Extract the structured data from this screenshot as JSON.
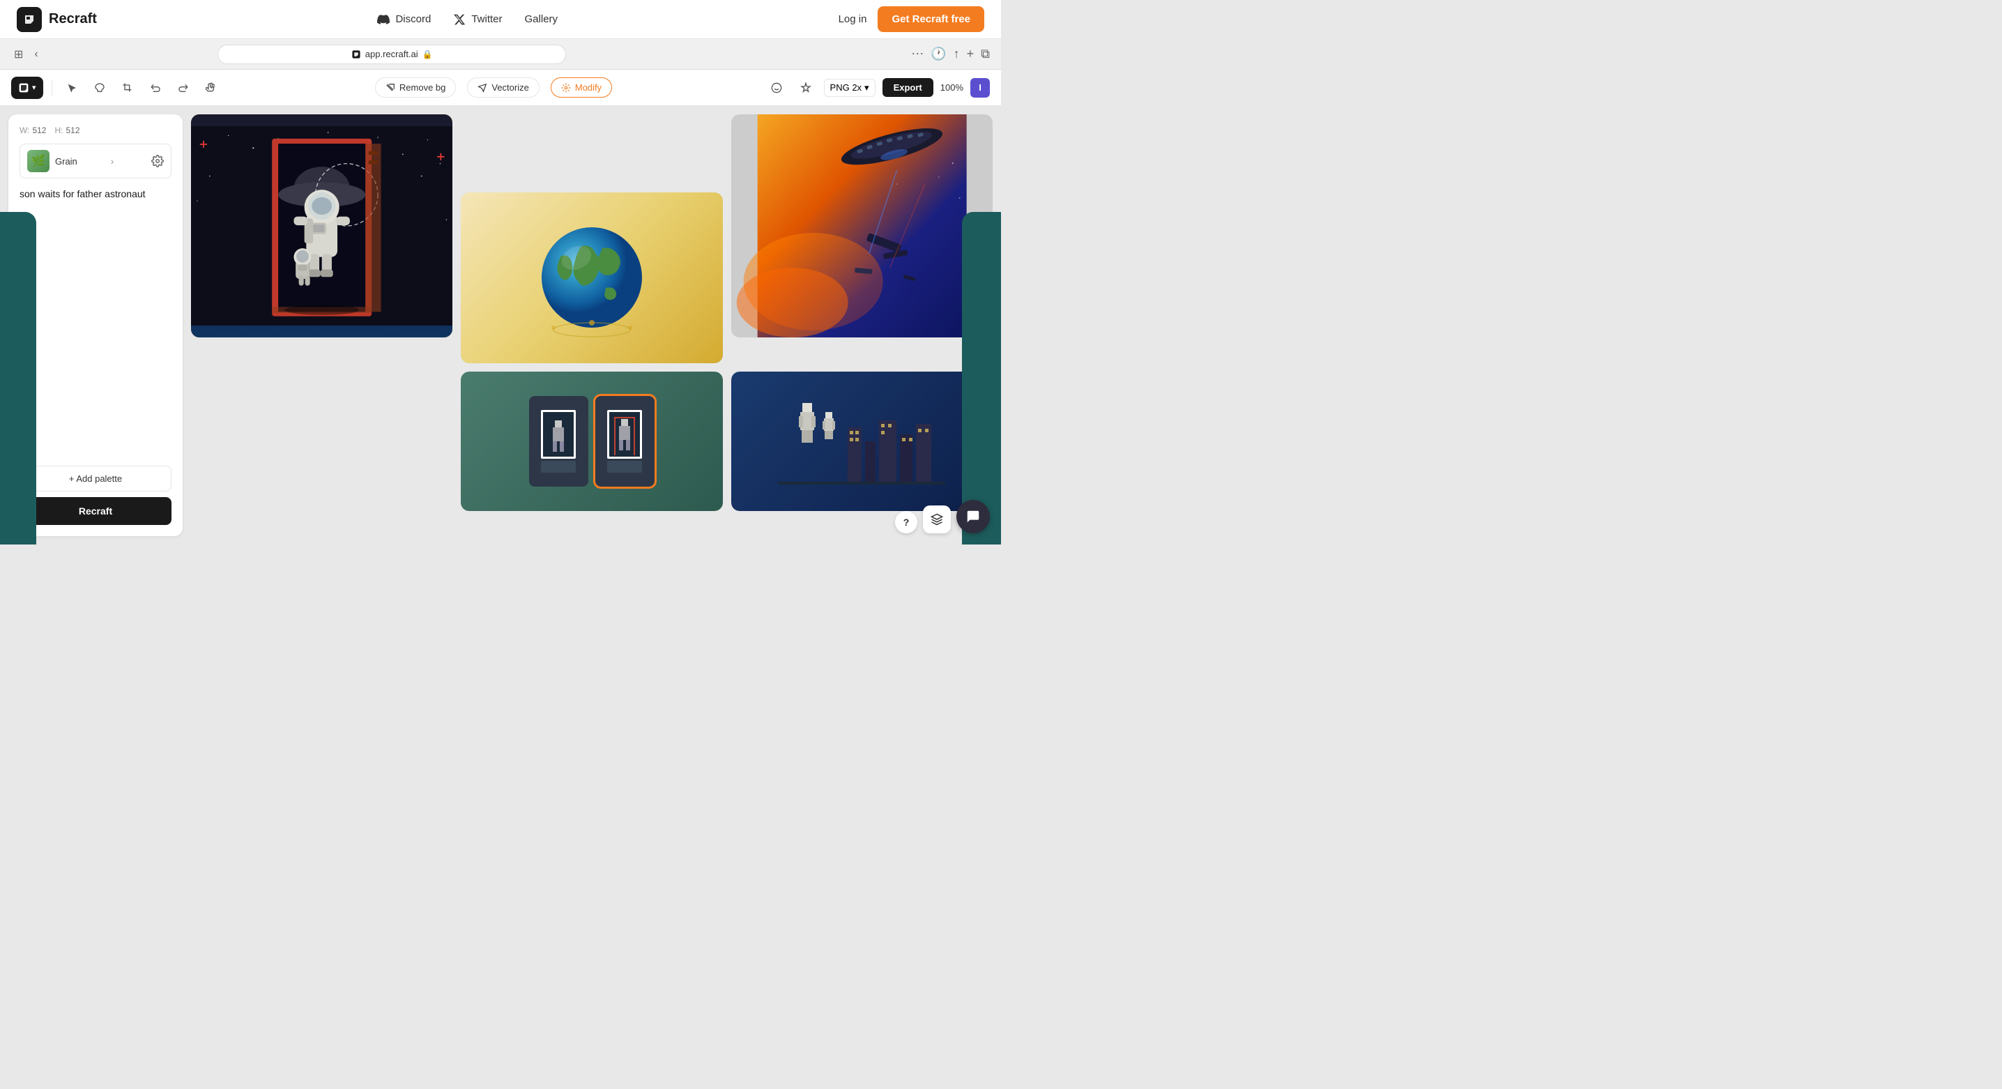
{
  "nav": {
    "logo_text": "Recraft",
    "logo_icon": "R",
    "discord_label": "Discord",
    "twitter_label": "Twitter",
    "gallery_label": "Gallery",
    "login_label": "Log in",
    "get_free_label": "Get Recraft free"
  },
  "browser": {
    "url": "app.recraft.ai",
    "lock_icon": "🔒"
  },
  "toolbar": {
    "remove_bg_label": "Remove bg",
    "vectorize_label": "Vectorize",
    "modify_label": "Modify",
    "png_label": "PNG 2x",
    "export_label": "Export",
    "zoom_level": "100%",
    "user_initial": "I"
  },
  "left_panel": {
    "width": "512",
    "height": "512",
    "width_label": "W:",
    "height_label": "H:",
    "style_name": "Grain",
    "prompt_text": "son waits for father astronaut",
    "add_palette_label": "+ Add palette",
    "recraft_label": "Recraft"
  },
  "images": {
    "main_alt": "Son waits for father astronaut - grain style illustration",
    "earth_alt": "Earth globe illustration",
    "space_battle_alt": "Space battle illustration",
    "pixel_art_alt": "Pixel art characters",
    "pixel_art2_alt": "Pixel art characters 2"
  },
  "bottom": {
    "chat_icon": "💬",
    "layers_icon": "⊞",
    "help_icon": "?"
  }
}
